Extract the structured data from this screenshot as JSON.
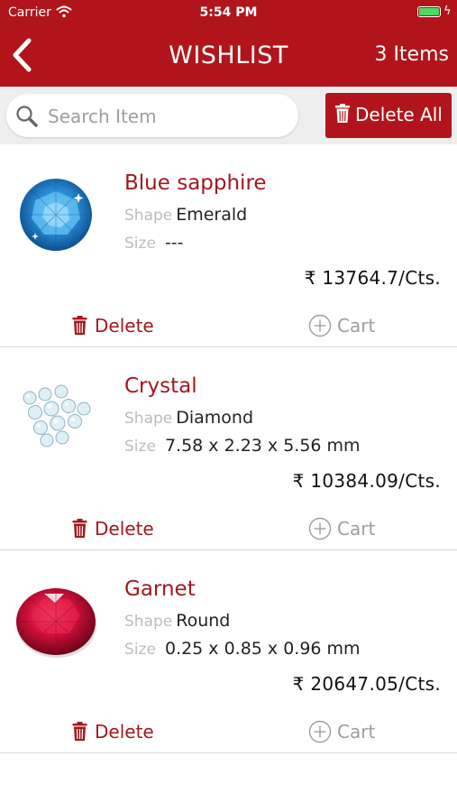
{
  "status_bar": {
    "carrier": "Carrier",
    "time": "5:54 PM"
  },
  "nav": {
    "title": "WISHLIST",
    "count": "3 Items",
    "back_icon": "chevron-left-icon"
  },
  "search": {
    "placeholder": "Search Item",
    "value": ""
  },
  "toolbar": {
    "delete_all_label": "Delete All"
  },
  "labels": {
    "shape": "Shape",
    "size": "Size",
    "delete": "Delete",
    "cart": "Cart"
  },
  "items": [
    {
      "name": "Blue sapphire",
      "shape": "Emerald",
      "size": "---",
      "price": "₹ 13764.7/Cts.",
      "image": "blue-sapphire-image"
    },
    {
      "name": "Crystal",
      "shape": "Diamond",
      "size": "7.58 x 2.23 x 5.56 mm",
      "price": "₹ 10384.09/Cts.",
      "image": "crystal-image"
    },
    {
      "name": "Garnet",
      "shape": "Round",
      "size": "0.25 x 0.85 x 0.96 mm",
      "price": "₹ 20647.05/Cts.",
      "image": "garnet-image"
    }
  ],
  "colors": {
    "brand_red": "#b1151b",
    "text_red": "#a3181e",
    "muted": "#bcbcbc",
    "search_bg": "#eeeeee",
    "battery": "#4cd964"
  }
}
